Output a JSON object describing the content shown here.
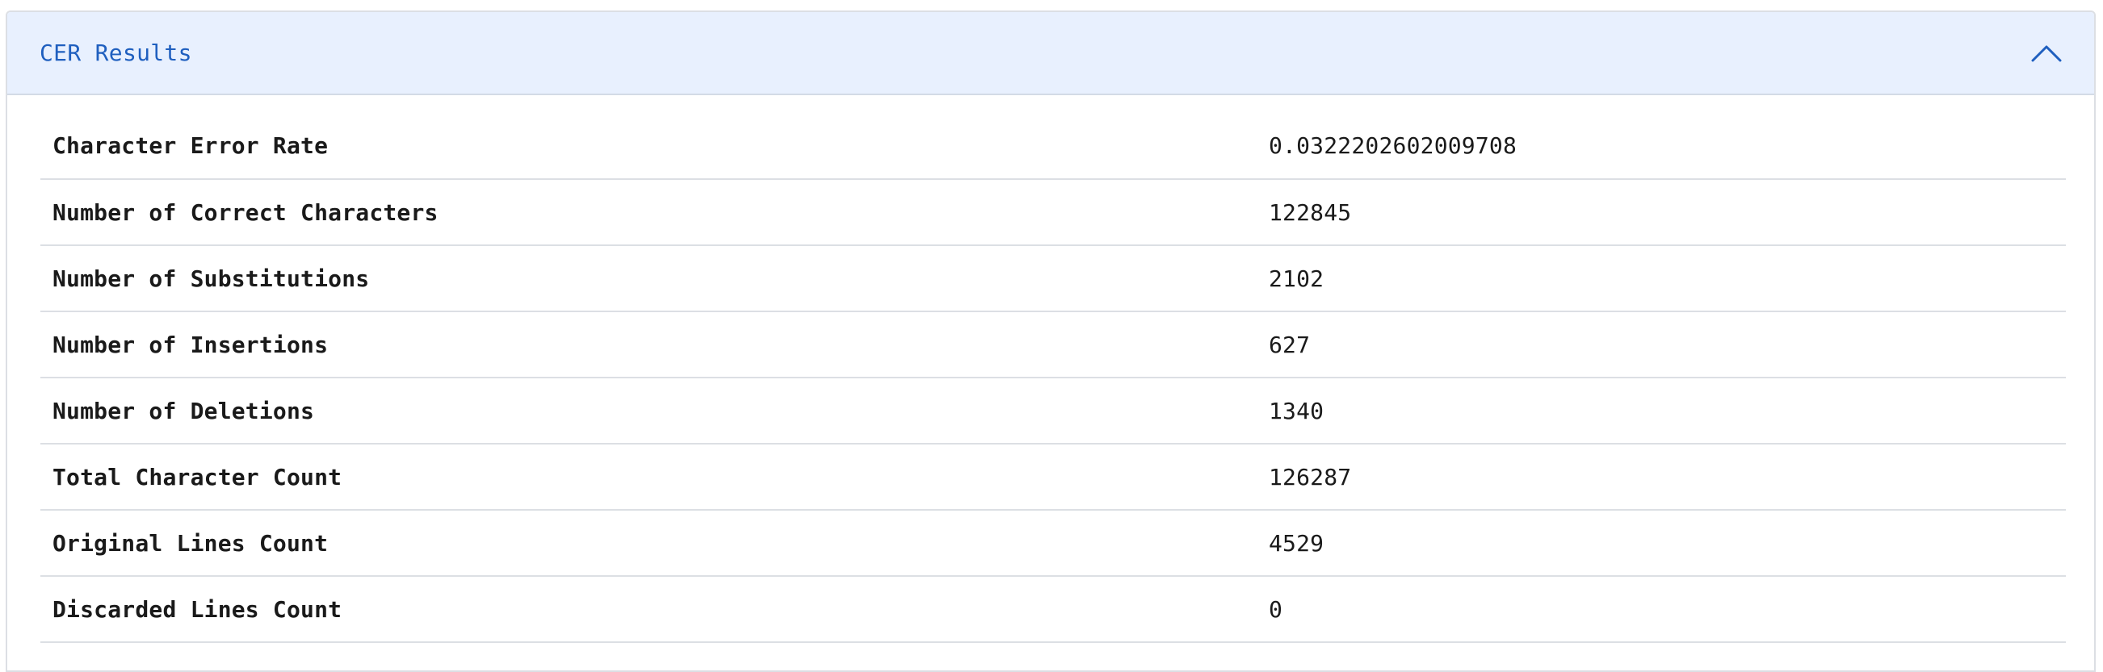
{
  "panel": {
    "title": "CER Results",
    "toggle_icon": "chevron-up-icon",
    "accent_color": "#1f5fbf",
    "header_background": "#e8f0fe"
  },
  "results": [
    {
      "label": "Character Error Rate",
      "value": "0.0322202602009708"
    },
    {
      "label": "Number of Correct Characters",
      "value": "122845"
    },
    {
      "label": "Number of Substitutions",
      "value": "2102"
    },
    {
      "label": "Number of Insertions",
      "value": "627"
    },
    {
      "label": "Number of Deletions",
      "value": "1340"
    },
    {
      "label": "Total Character Count",
      "value": "126287"
    },
    {
      "label": "Original Lines Count",
      "value": "4529"
    },
    {
      "label": "Discarded Lines Count",
      "value": "0"
    }
  ]
}
